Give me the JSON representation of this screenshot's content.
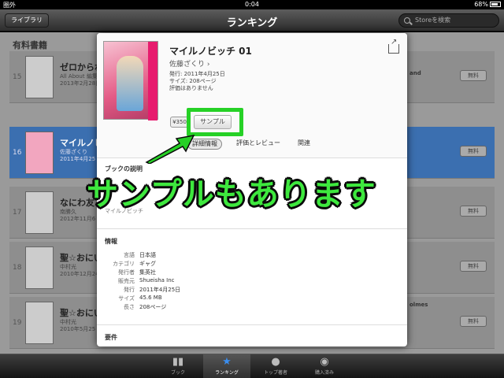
{
  "status": {
    "carrier": "圏外",
    "time": "0:04",
    "battery": "68%"
  },
  "nav": {
    "library_button": "ライブラリ",
    "title": "ランキング",
    "search_placeholder": "Storeを検索"
  },
  "list": {
    "header": "有料書籍",
    "rows": [
      {
        "rank": "15",
        "title": "ゼロからわか",
        "sub1": "All About 編集部",
        "sub2": "2013年2月28日",
        "buy": "無料"
      },
      {
        "rank": "16",
        "title": "マイルノビ",
        "sub1": "佐藤ざくり",
        "sub2": "2011年4月25",
        "buy": "無料"
      },
      {
        "rank": "17",
        "title": "なにわ友あ",
        "sub1": "南勝久",
        "sub2": "2012年11月6",
        "buy": "無料"
      },
      {
        "rank": "18",
        "title": "聖☆おにい",
        "sub1": "中村光",
        "sub2": "2010年12月24",
        "buy": "無料"
      },
      {
        "rank": "19",
        "title": "聖☆おにい",
        "sub1": "中村光",
        "sub2": "2010年5月25",
        "buy": "無料"
      }
    ],
    "right_peek_1": "and",
    "right_peek_2": "olmes"
  },
  "popover": {
    "title": "マイルノビッチ 01",
    "author": "佐藤ざくり ›",
    "release": "発行: 2011年4月25日",
    "size": "サイズ: 208ページ",
    "rating": "評価はありません",
    "price": "¥350",
    "sample": "サンプル",
    "tabs": [
      "詳細情報",
      "評価とレビュー",
      "関連"
    ],
    "description_title": "ブックの説明",
    "description_tail": "マイルノビッチ",
    "info_title": "情報",
    "info": [
      {
        "label": "言語",
        "value": "日本語"
      },
      {
        "label": "カテゴリ",
        "value": "ギャグ"
      },
      {
        "label": "発行者",
        "value": "集英社"
      },
      {
        "label": "販売元",
        "value": "Shueisha Inc"
      },
      {
        "label": "発行",
        "value": "2011年4月25日"
      },
      {
        "label": "サイズ",
        "value": "45.6 MB"
      },
      {
        "label": "長さ",
        "value": "208ページ"
      }
    ],
    "requirements_title": "要件"
  },
  "overlay_text": "サンプルもあります",
  "tabbar": [
    "ブック",
    "ランキング",
    "トップ著者",
    "購入済み"
  ],
  "colors": {
    "highlight": "#26d126",
    "selected_row": "#3b6fb0",
    "tab_selected_icon": "#3a8ef0"
  }
}
